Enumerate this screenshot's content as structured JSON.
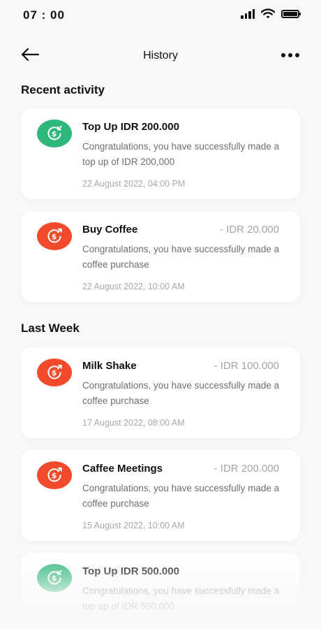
{
  "status_bar": {
    "time": "07 : 00"
  },
  "nav": {
    "title": "History",
    "back_icon": "arrow-left-icon",
    "more_icon": "more-horizontal-icon"
  },
  "sections": {
    "recent": "Recent activity",
    "last_week": "Last Week"
  },
  "colors": {
    "topup": "#2eb77a",
    "purchase": "#f34a2b",
    "background": "#f8f8f8"
  },
  "recent_items": [
    {
      "type": "topup",
      "icon": "dollar-receive-icon",
      "title": "Top Up IDR 200.000",
      "amount": "",
      "desc": "Congratulations, you have successfully made a top up of IDR 200,000",
      "time": "22 August 2022, 04:00 PM"
    },
    {
      "type": "purchase",
      "icon": "dollar-send-icon",
      "title": "Buy Coffee",
      "amount": "- IDR 20.000",
      "desc": "Congratulations, you have successfully made a coffee purchase",
      "time": "22 August 2022, 10:00 AM"
    }
  ],
  "last_week_items": [
    {
      "type": "purchase",
      "icon": "dollar-send-icon",
      "title": "Milk Shake",
      "amount": "- IDR 100.000",
      "desc": "Congratulations, you have successfully made a coffee purchase",
      "time": "17 August 2022, 08:00 AM"
    },
    {
      "type": "purchase",
      "icon": "dollar-send-icon",
      "title": "Caffee Meetings",
      "amount": "- IDR 200.000",
      "desc": "Congratulations, you have successfully made a coffee purchase",
      "time": "15 August 2022, 10:00 AM"
    },
    {
      "type": "topup",
      "icon": "dollar-receive-icon",
      "title": "Top Up IDR 500.000",
      "amount": "",
      "desc": "Congratulations, you have successfully made a top up of IDR 500,000",
      "time": ""
    }
  ]
}
